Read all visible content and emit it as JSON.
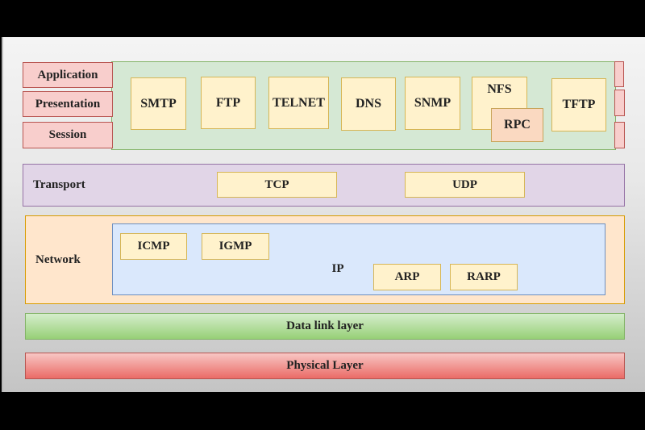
{
  "diagram": {
    "upper_layers": {
      "labels": [
        "Application",
        "Presentation",
        "Session"
      ],
      "protocols": [
        "SMTP",
        "FTP",
        "TELNET",
        "DNS",
        "SNMP",
        "NFS",
        "RPC",
        "TFTP"
      ]
    },
    "transport": {
      "label": "Transport",
      "protocols": [
        "TCP",
        "UDP"
      ]
    },
    "network": {
      "label": "Network",
      "ip_label": "IP",
      "protocols": [
        "ICMP",
        "IGMP",
        "ARP",
        "RARP"
      ]
    },
    "data_link": {
      "label": "Data link layer"
    },
    "physical": {
      "label": "Physical Layer"
    }
  },
  "colors": {
    "upper_layer_label": "#f8cecc",
    "application_area": "#d5e8d4",
    "protocol_box": "#fff2cc",
    "transport": "#e1d5e7",
    "network": "#ffe6cc",
    "ip_area": "#dae8fc",
    "data_link": "#97d077",
    "physical": "#ea6b66"
  }
}
